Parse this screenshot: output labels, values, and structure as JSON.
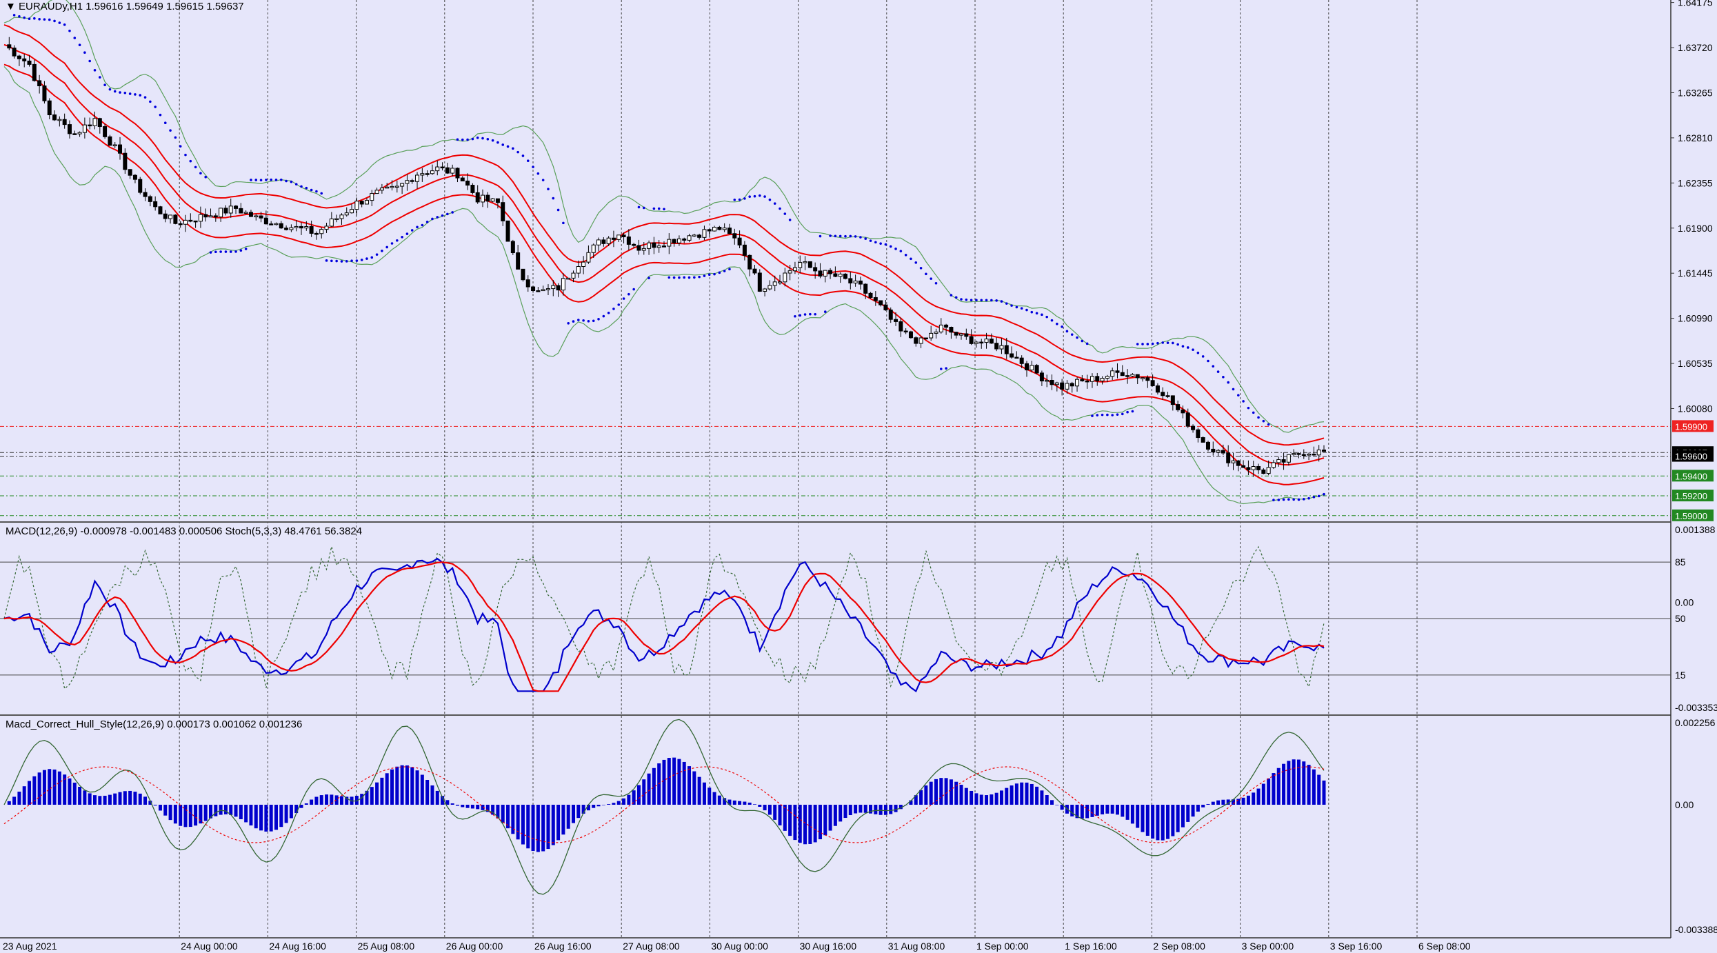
{
  "chart_data": {
    "type": "candlestick",
    "symbol": "EURAUDy,H1",
    "ohlc_header": "1.59616 1.59649 1.59615 1.59637",
    "price_axis_ticks": [
      "1.64175",
      "1.63720",
      "1.63265",
      "1.62810",
      "1.62355",
      "1.61900",
      "1.61445",
      "1.60990",
      "1.60535",
      "1.60080",
      "1.59637",
      "1.59600"
    ],
    "price_range": [
      1.5895,
      1.642
    ],
    "time_labels": [
      "23 Aug 2021",
      "24 Aug 00:00",
      "24 Aug 16:00",
      "25 Aug 08:00",
      "26 Aug 00:00",
      "26 Aug 16:00",
      "27 Aug 08:00",
      "30 Aug 00:00",
      "30 Aug 16:00",
      "31 Aug 08:00",
      "1 Sep 00:00",
      "1 Sep 16:00",
      "2 Sep 08:00",
      "3 Sep 00:00",
      "3 Sep 16:00",
      "6 Sep 08:00"
    ],
    "level_tags": [
      {
        "price": 1.599,
        "label": "1.59900",
        "color": "#ee2222"
      },
      {
        "price": 1.59637,
        "label": "1.59637",
        "color": "#000000"
      },
      {
        "price": 1.596,
        "label": "1.59600",
        "color": "#000000"
      },
      {
        "price": 1.594,
        "label": "1.59400",
        "color": "#228822"
      },
      {
        "price": 1.592,
        "label": "1.59200",
        "color": "#228822"
      },
      {
        "price": 1.59,
        "label": "1.59000",
        "color": "#228822"
      }
    ],
    "price_path": [
      [
        0,
        1.6375
      ],
      [
        5,
        1.6355
      ],
      [
        9,
        1.6305
      ],
      [
        14,
        1.6285
      ],
      [
        18,
        1.63
      ],
      [
        22,
        1.627
      ],
      [
        26,
        1.6235
      ],
      [
        30,
        1.621
      ],
      [
        34,
        1.6195
      ],
      [
        38,
        1.62
      ],
      [
        42,
        1.6205
      ],
      [
        46,
        1.621
      ],
      [
        50,
        1.62
      ],
      [
        54,
        1.6195
      ],
      [
        58,
        1.619
      ],
      [
        62,
        1.6185
      ],
      [
        66,
        1.62
      ],
      [
        70,
        1.6215
      ],
      [
        74,
        1.6225
      ],
      [
        78,
        1.623
      ],
      [
        82,
        1.6245
      ],
      [
        86,
        1.625
      ],
      [
        90,
        1.6245
      ],
      [
        94,
        1.622
      ],
      [
        98,
        1.6215
      ],
      [
        102,
        1.6145
      ],
      [
        106,
        1.6125
      ],
      [
        110,
        1.613
      ],
      [
        114,
        1.6155
      ],
      [
        118,
        1.6175
      ],
      [
        122,
        1.6185
      ],
      [
        126,
        1.617
      ],
      [
        130,
        1.6175
      ],
      [
        134,
        1.618
      ],
      [
        138,
        1.6185
      ],
      [
        142,
        1.619
      ],
      [
        146,
        1.6175
      ],
      [
        150,
        1.613
      ],
      [
        154,
        1.614
      ],
      [
        158,
        1.6155
      ],
      [
        162,
        1.6145
      ],
      [
        166,
        1.614
      ],
      [
        170,
        1.613
      ],
      [
        174,
        1.611
      ],
      [
        178,
        1.6085
      ],
      [
        182,
        1.6075
      ],
      [
        186,
        1.609
      ],
      [
        190,
        1.608
      ],
      [
        194,
        1.6075
      ],
      [
        198,
        1.607
      ],
      [
        202,
        1.6055
      ],
      [
        206,
        1.604
      ],
      [
        210,
        1.603
      ],
      [
        214,
        1.6035
      ],
      [
        218,
        1.604
      ],
      [
        222,
        1.6045
      ],
      [
        226,
        1.604
      ],
      [
        230,
        1.6025
      ],
      [
        234,
        1.6
      ],
      [
        238,
        1.5975
      ],
      [
        242,
        1.596
      ],
      [
        246,
        1.595
      ],
      [
        250,
        1.5945
      ],
      [
        254,
        1.5955
      ],
      [
        258,
        1.5965
      ],
      [
        262,
        1.5964
      ]
    ],
    "macd_stoch_header": "MACD(12,26,9) -0.000978 -0.001483 0.000506  Stoch(5,3,3) 48.4761 56.3824",
    "macd_stoch_axis": [
      "0.001388",
      "85",
      "0.00",
      "50",
      "15",
      "-0.003353"
    ],
    "hull_header": "Macd_Correct_Hull_Style(12,26,9) 0.000173 0.001062 0.001236",
    "hull_axis": [
      "0.002256",
      "0.00",
      "-0.003388"
    ],
    "colors": {
      "candle": "#000000",
      "ma": "#ee0000",
      "bollinger": "#5aa05a",
      "sar": "#0000dd",
      "macd": "#0000cc",
      "signal": "#ee0000",
      "stoch": "#336633",
      "hist": "#0000cc",
      "bg": "#e6e6fa"
    }
  }
}
